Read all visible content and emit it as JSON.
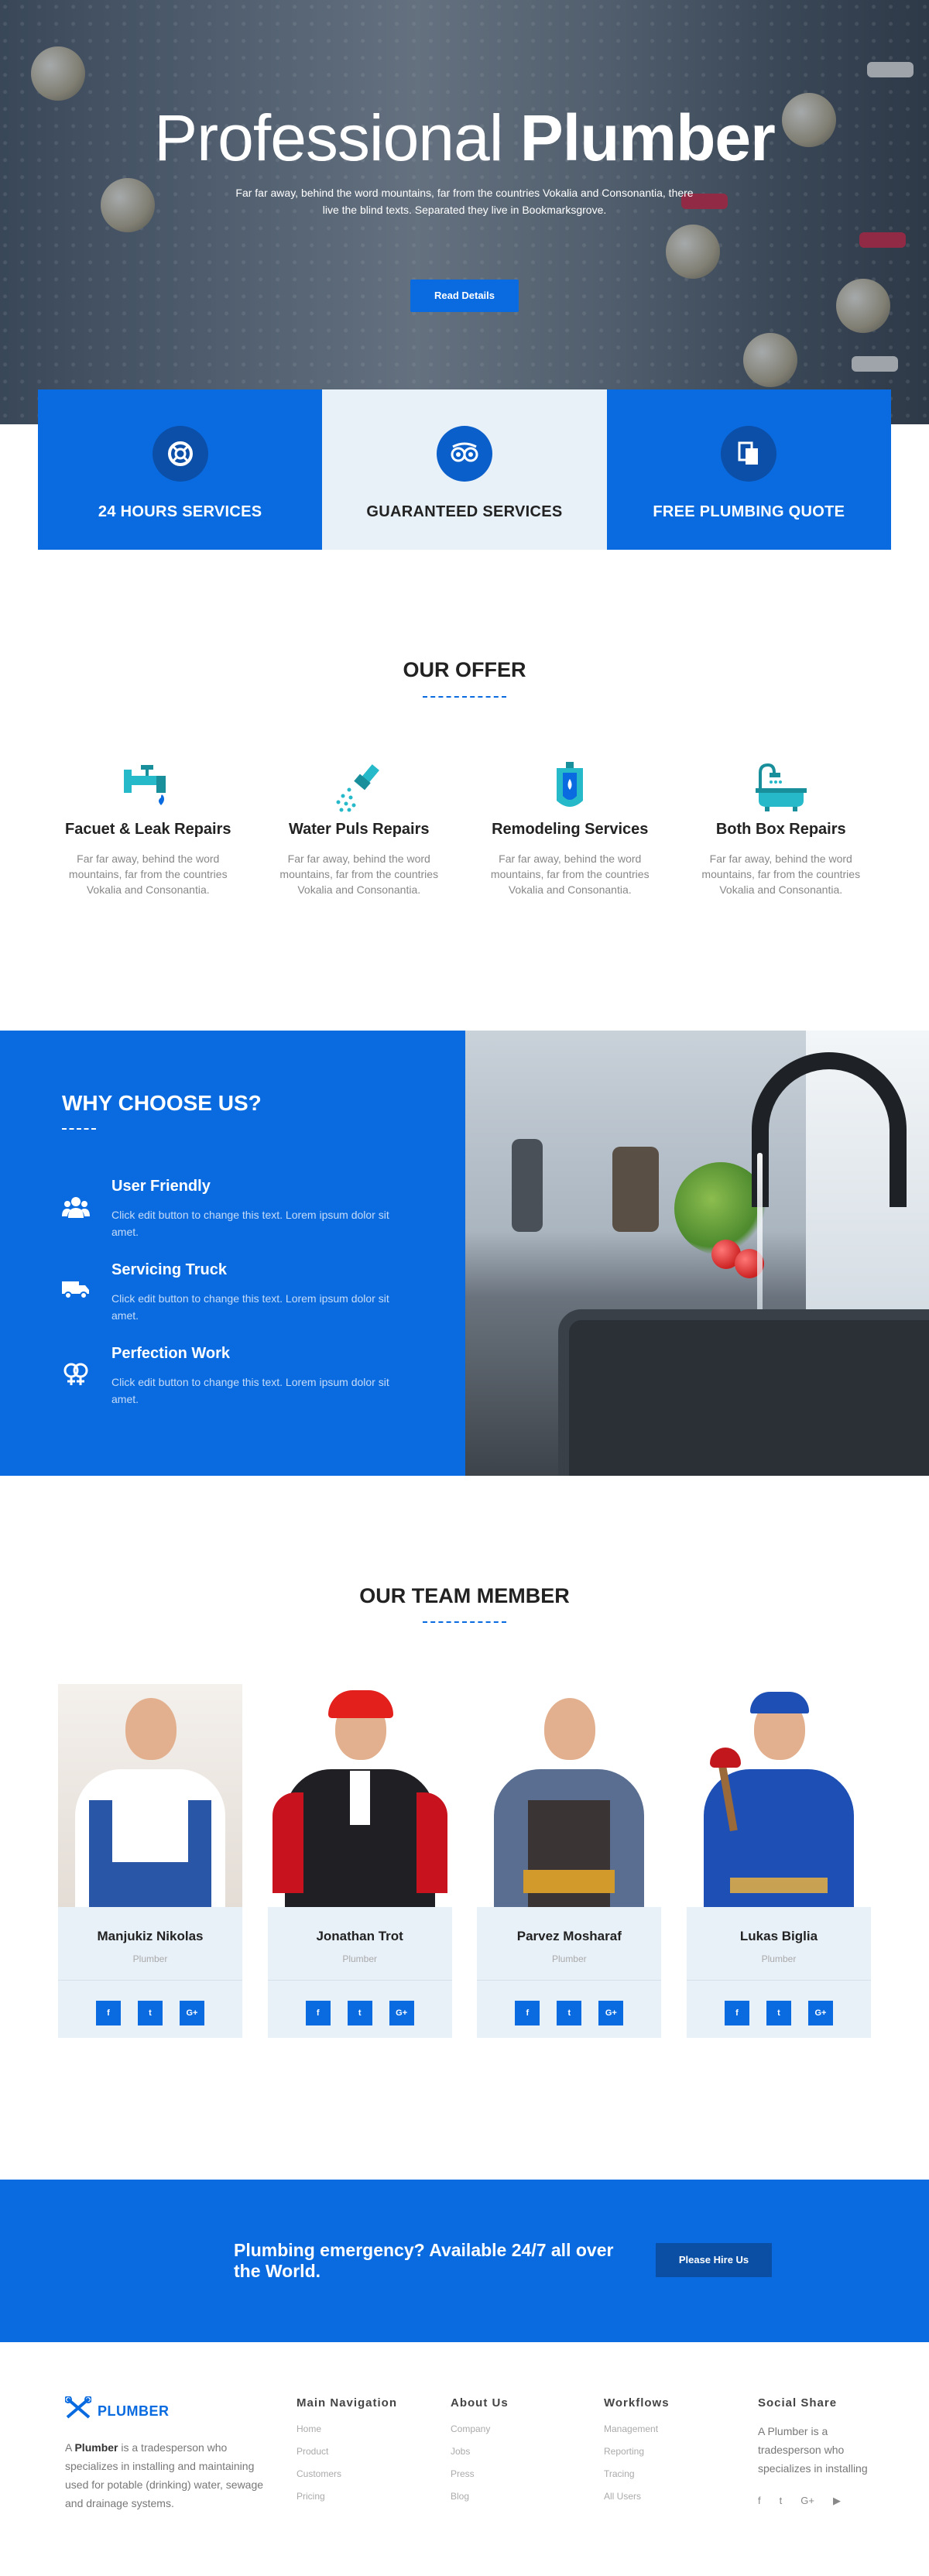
{
  "hero": {
    "title_light": "Professional",
    "title_bold": "Plumber",
    "subtitle": "Far far away, behind the word mountains, far from the countries Vokalia and Consonantia, there live the blind texts. Separated they live in Bookmarksgrove.",
    "button": "Read Details"
  },
  "services": [
    {
      "label": "24 HOURS SERVICES",
      "icon": "lifebuoy-icon",
      "glyph": "⛑"
    },
    {
      "label": "GUARANTEED SERVICES",
      "icon": "owl-eyes-icon",
      "glyph": "◎◎"
    },
    {
      "label": "FREE PLUMBING QUOTE",
      "icon": "document-icon",
      "glyph": "❐"
    }
  ],
  "offer": {
    "title": "OUR OFFER",
    "items": [
      {
        "title": "Facuet & Leak Repairs",
        "text": "Far far away, behind the word mountains, far from the countries Vokalia and Consonantia."
      },
      {
        "title": "Water Puls Repairs",
        "text": "Far far away, behind the word mountains, far from the countries Vokalia and Consonantia."
      },
      {
        "title": "Remodeling Services",
        "text": "Far far away, behind the word mountains, far from the countries Vokalia and Consonantia."
      },
      {
        "title": "Both Box Repairs",
        "text": "Far far away, behind the word mountains, far from the countries Vokalia and Consonantia."
      }
    ]
  },
  "why": {
    "title": "WHY CHOOSE US?",
    "items": [
      {
        "title": "User Friendly",
        "text": "Click edit button to change this text. Lorem ipsum dolor sit amet.",
        "icon": "users-icon"
      },
      {
        "title": "Servicing Truck",
        "text": "Click edit button to change this text. Lorem ipsum dolor sit amet.",
        "icon": "truck-icon"
      },
      {
        "title": "Perfection Work",
        "text": "Click edit button to change this text. Lorem ipsum dolor sit amet.",
        "icon": "gender-icon"
      }
    ]
  },
  "team": {
    "title": "OUR TEAM MEMBER",
    "members": [
      {
        "name": "Manjukiz Nikolas",
        "role": "Plumber"
      },
      {
        "name": "Jonathan Trot",
        "role": "Plumber"
      },
      {
        "name": "Parvez Mosharaf",
        "role": "Plumber"
      },
      {
        "name": "Lukas Biglia",
        "role": "Plumber"
      }
    ],
    "social": [
      "f",
      "t",
      "G+"
    ]
  },
  "cta": {
    "text": "Plumbing emergency? Available 24/7 all over the World.",
    "button": "Please Hire Us"
  },
  "footer": {
    "logo": "PLUMBER",
    "about_prefix": "A ",
    "about_bold": "Plumber",
    "about_rest": " is a tradesperson who specializes in installing and maintaining used for potable (drinking) water, sewage and drainage systems.",
    "columns": [
      {
        "title": "Main Navigation",
        "links": [
          "Home",
          "Product",
          "Customers",
          "Pricing"
        ]
      },
      {
        "title": "About Us",
        "links": [
          "Company",
          "Jobs",
          "Press",
          "Blog"
        ]
      },
      {
        "title": "Workflows",
        "links": [
          "Management",
          "Reporting",
          "Tracing",
          "All Users"
        ]
      }
    ],
    "social": {
      "title": "Social Share",
      "text": "A Plumber is a tradesperson who specializes in installing",
      "icons": [
        "f",
        "t",
        "G+",
        "▶"
      ]
    }
  },
  "colors": {
    "primary": "#0a6be0",
    "light": "#e8f0f8",
    "dark_button": "#0a4fa4"
  }
}
